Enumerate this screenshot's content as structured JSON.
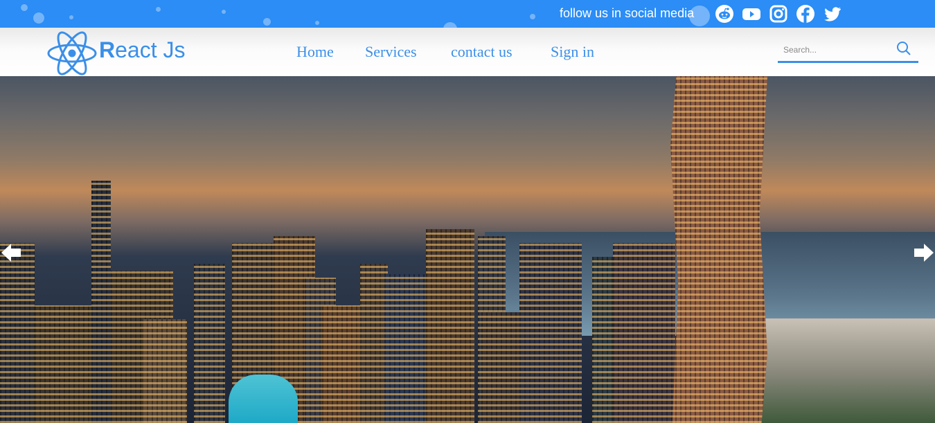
{
  "topbar": {
    "follow_text": "follow us in social media",
    "social": [
      {
        "icon": "reddit-icon"
      },
      {
        "icon": "youtube-icon"
      },
      {
        "icon": "instagram-icon"
      },
      {
        "icon": "facebook-icon"
      },
      {
        "icon": "twitter-icon"
      }
    ]
  },
  "brand": {
    "initial": "R",
    "rest": "eact Js"
  },
  "nav": {
    "home": "Home",
    "services": "Services",
    "contact": "contact us",
    "signin": "Sign in"
  },
  "search": {
    "placeholder": "Search...",
    "value": ""
  },
  "colors": {
    "topbar": "#2b8df5",
    "accent": "#3a8fe8"
  },
  "carousel": {
    "prev_icon": "arrow-left-icon",
    "next_icon": "arrow-right-icon"
  }
}
